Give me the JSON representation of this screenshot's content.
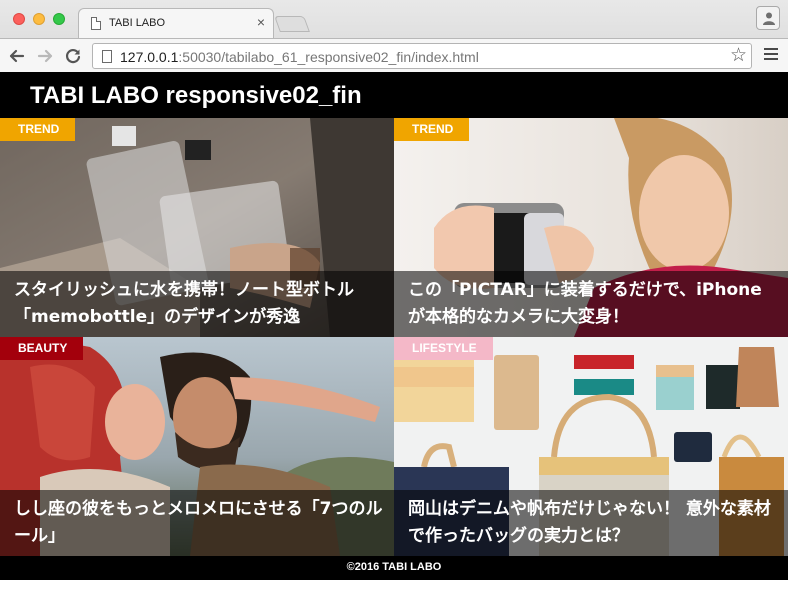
{
  "browser": {
    "tab_title": "TABI LABO",
    "tab_close": "×",
    "url_host": "127.0.0.1",
    "url_rest": ":50030/tabilabo_61_responsive02_fin/index.html",
    "star": "☆"
  },
  "site": {
    "title": "TABI LABO responsive02_fin",
    "footer": "©2016 TABI LABO"
  },
  "articles": [
    {
      "category": "TREND",
      "category_color": "#f0a500",
      "caption": "スタイリッシュに水を携帯！ノート型ボトル「memobottle」のデザインが秀逸"
    },
    {
      "category": "TREND",
      "category_color": "#f0a500",
      "caption": "この「PICTAR」に装着するだけで、iPhoneが本格的なカメラに大変身！"
    },
    {
      "category": "BEAUTY",
      "category_color": "#a3000c",
      "caption": "しし座の彼をもっとメロメロにさせる「7つのルール」"
    },
    {
      "category": "LIFESTYLE",
      "category_color": "#f4b8c8",
      "caption": "岡山はデニムや帆布だけじゃない！ 意外な素材で作ったバッグの実力とは？"
    }
  ]
}
